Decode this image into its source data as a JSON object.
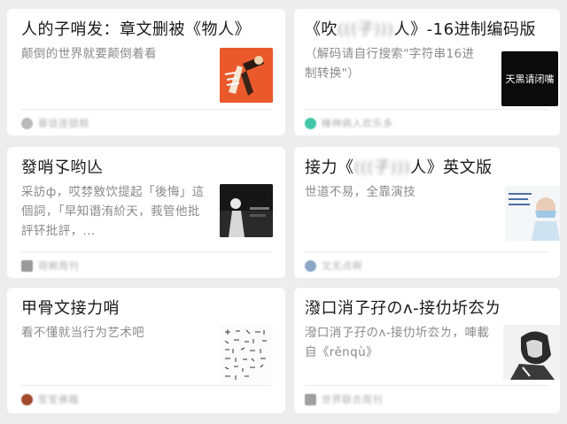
{
  "cards": [
    {
      "title": "人的子哨发：章文删被《物人》",
      "desc": "颠倒的世界就要颠倒着看",
      "source": "暴徒连锁频",
      "avatar_color": "#b9b9b9",
      "thumb_icon": "illustration-thumbnail"
    },
    {
      "title_a": "《吹",
      "title_blur": "(((子)))",
      "title_b": "人》-16进制编码版",
      "desc": "（解码请自行搜索\"字符串16进制转换\"）",
      "source": "睡神病人欢乐多",
      "avatar_color": "#3fc7a6",
      "thumb_text": "天黑请闭嘴"
    },
    {
      "title": "發哨孓哟亾",
      "desc": "采訪ф，哎棼敫饮提起「後悔」這個詞，「早知谮洧紒天，莪管他批評钚批評，...",
      "source": "荷赖周刊",
      "avatar_color": "#9a9a9a",
      "thumb_icon": "night-photo-thumbnail"
    },
    {
      "title_a": "接力《",
      "title_blur": "(((子)))",
      "title_b": "人》英文版",
      "desc": "世道不易，全靠演技",
      "source": "文无点啊",
      "avatar_color": "#8aa7c7",
      "thumb_icon": "doctor-photo-thumbnail"
    },
    {
      "title": "甲骨文接力哨",
      "desc": "看不懂就当行为艺术吧",
      "source": "笙笙佛箱",
      "avatar_color": "#a14a2e",
      "thumb_icon": "oracle-script-thumbnail"
    },
    {
      "title": "潑口消孒孖のʌ-接仂圻厺ㄌ",
      "desc": "潑口消孒孖のʌ-接仂圻厺ㄌ，唓載自《rěnqù》",
      "source": "世界联合周刊",
      "avatar_color": "#a0a0a0",
      "thumb_icon": "sketch-portrait-thumbnail"
    }
  ]
}
